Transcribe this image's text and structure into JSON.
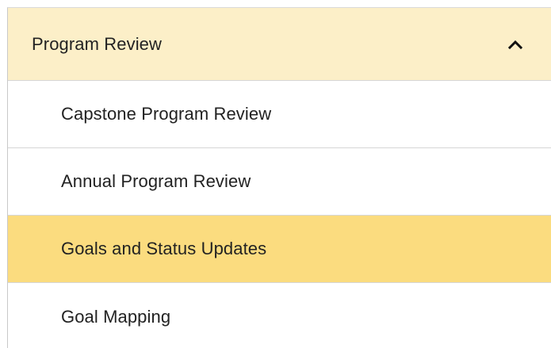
{
  "menu": {
    "header": {
      "label": "Program Review",
      "expanded": true,
      "icon": "chevron-up-icon",
      "background": "#fcefc8"
    },
    "active_background": "#fbdc7f",
    "items": [
      {
        "label": "Capstone Program Review",
        "active": false
      },
      {
        "label": "Annual Program Review",
        "active": false
      },
      {
        "label": "Goals and Status Updates",
        "active": true
      },
      {
        "label": "Goal Mapping",
        "active": false
      }
    ]
  }
}
